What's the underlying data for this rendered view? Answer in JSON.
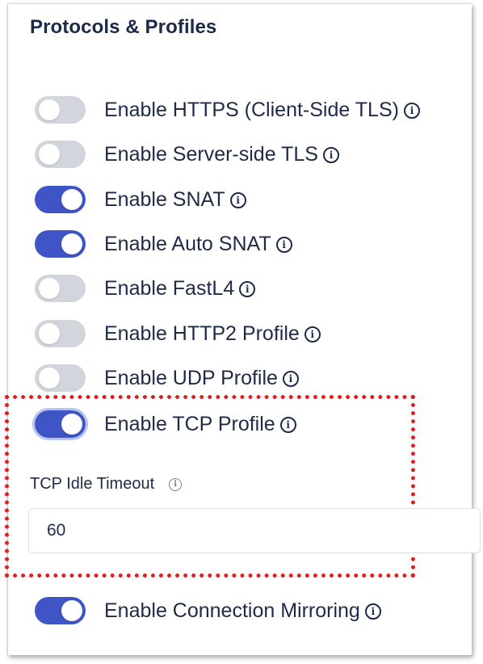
{
  "section": {
    "title": "Protocols & Profiles"
  },
  "toggles": [
    {
      "label": "Enable HTTPS (Client-Side TLS)",
      "state": "off"
    },
    {
      "label": "Enable Server-side TLS",
      "state": "off"
    },
    {
      "label": "Enable SNAT",
      "state": "on"
    },
    {
      "label": "Enable Auto SNAT",
      "state": "on"
    },
    {
      "label": "Enable FastL4",
      "state": "off"
    },
    {
      "label": "Enable HTTP2 Profile",
      "state": "off"
    },
    {
      "label": "Enable UDP Profile",
      "state": "off"
    },
    {
      "label": "Enable TCP Profile",
      "state": "on"
    },
    {
      "label": "Enable Connection Mirroring",
      "state": "on"
    }
  ],
  "tcp_idle_timeout": {
    "label": "TCP Idle Timeout",
    "value": "60"
  },
  "colors": {
    "toggle_on": "#3f55c6",
    "toggle_off": "#d3d5dc",
    "highlight": "#e01f1f",
    "text": "#1e2a48"
  },
  "icons": {
    "info": "info-circle-icon"
  }
}
